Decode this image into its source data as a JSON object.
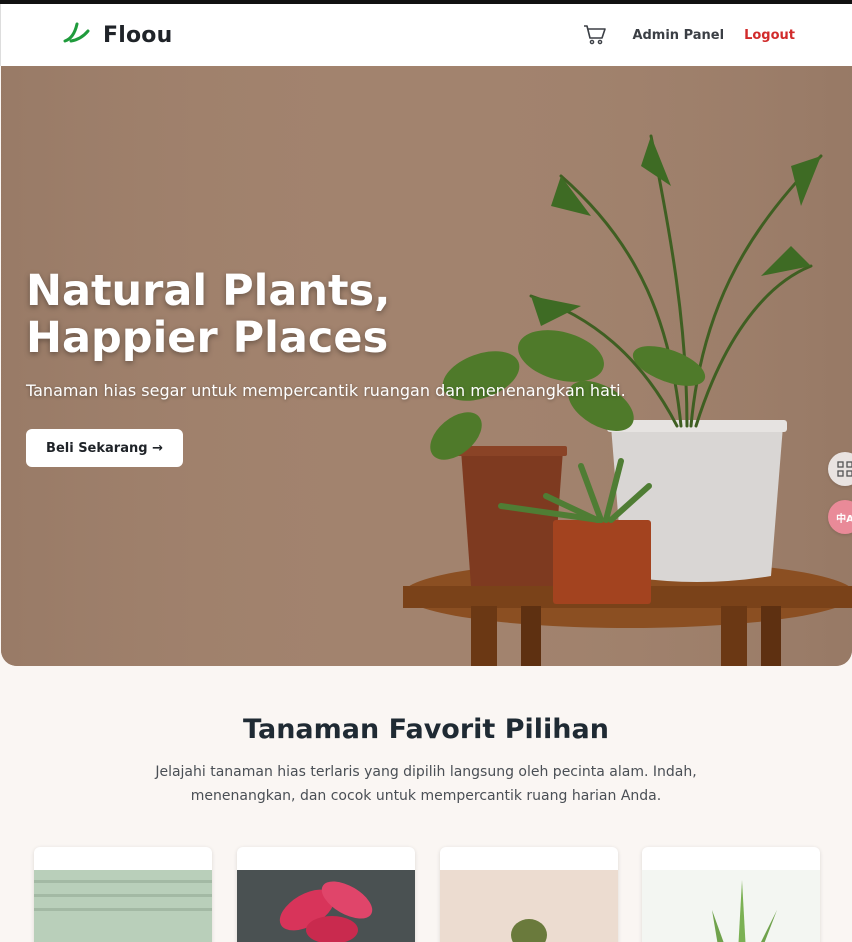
{
  "header": {
    "brand": "Floou",
    "nav": {
      "admin_label": "Admin Panel",
      "logout_label": "Logout"
    },
    "icons": {
      "logo": "leaf-icon",
      "cart": "cart-icon"
    }
  },
  "hero": {
    "title_line1": "Natural Plants,",
    "title_line2": "Happier Places",
    "subtitle": "Tanaman hias segar untuk mempercantik ruangan dan menenangkan hati.",
    "cta_label": "Beli Sekarang →"
  },
  "featured": {
    "title": "Tanaman Favorit Pilihan",
    "description": "Jelajahi tanaman hias terlaris yang dipilih langsung oleh pecinta alam. Indah, menenangkan, dan cocok untuk mempercantik ruang harian Anda."
  },
  "side_tools": {
    "translate_label": "中A"
  },
  "colors": {
    "accent_green": "#1f9b3c",
    "logout_red": "#d12b2b",
    "hero_brown": "#a0826d"
  }
}
